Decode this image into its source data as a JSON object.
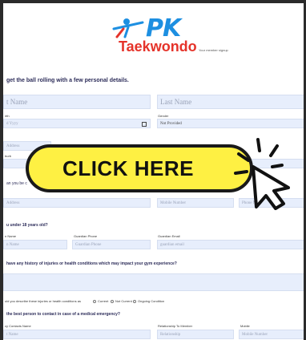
{
  "brand": {
    "name": "PK",
    "subtitle": "Taekwondo",
    "tagline": "Your member signup"
  },
  "sections": {
    "personal": "get the ball rolling with a few personal details.",
    "under18": "u under 18 years old?",
    "health": "have any history of injuries or health conditions which may impact your gym experience?",
    "emergency": "the best person to contact in case of a medical emergency?"
  },
  "fields": {
    "first_name_placeholder": "t Name",
    "last_name_placeholder": "Last Name",
    "birth_label": "irth",
    "birth_placeholder": "d Yyyy",
    "gender_label": "Gender",
    "gender_value": "Not Provided",
    "address_placeholder": "Address",
    "suburb_label": "burb",
    "contact_prefix": "an you be c",
    "contact_email_placeholder": "Address",
    "mobile_placeholder": "Mobile Number",
    "phone_placeholder": "Phone Num",
    "guardian_name_label": "n Name",
    "guardian_name_placeholder": "n Name",
    "guardian_phone_label": "Guardian Phone",
    "guardian_phone_placeholder": "Guardian Phone",
    "guardian_email_label": "Guardian Email",
    "guardian_email_placeholder": "guardian email",
    "describe_label": "uld you describe these injuries or health conditions as",
    "radio_current": "Current",
    "radio_not_current": "Not Current",
    "radio_ongoing": "Ongoing Condition",
    "ec_name_label": "cy Contacts Name",
    "ec_name_placeholder": "t Name",
    "relationship_label": "Relationship To Member",
    "relationship_placeholder": "Relationship",
    "ec_mobile_label": "Mobile",
    "ec_mobile_placeholder": "Mobile Number"
  },
  "cta": {
    "label": "CLICK HERE"
  },
  "colors": {
    "brand_blue": "#1d8fe1",
    "brand_red": "#e5332a",
    "cta_yellow": "#fef043",
    "input_bg": "#e7eefc",
    "heading": "#2d2d5a"
  }
}
